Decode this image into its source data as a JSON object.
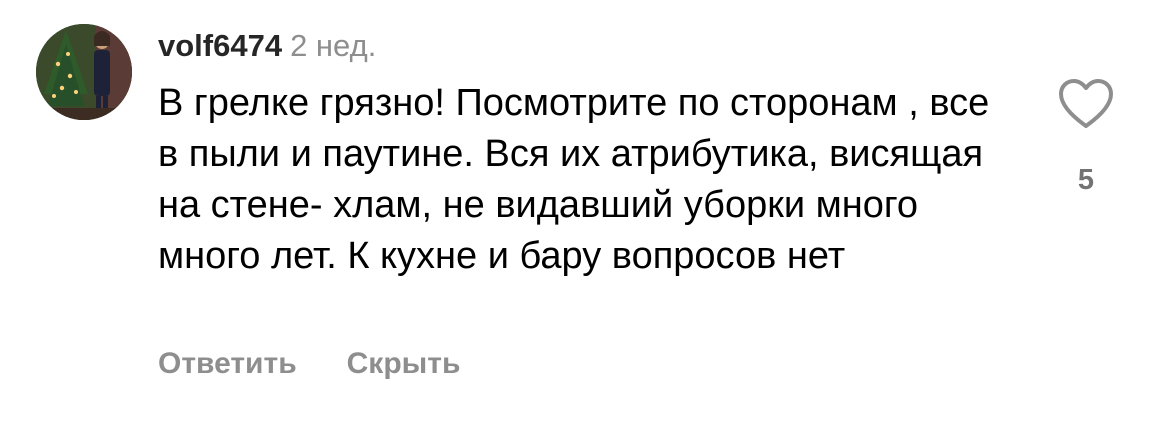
{
  "comment": {
    "avatar_icon": "user-avatar-photo",
    "username": "volf6474",
    "timestamp": "2 нед.",
    "text": "В грелке грязно! Посмотрите по сторонам , все в пыли и паутине. Вся их атрибутика, висящая на стене- хлам, не видавший уборки много много лет. К кухне и бару вопросов нет",
    "like_icon": "heart-outline-icon",
    "like_count": "5",
    "actions": {
      "reply_label": "Ответить",
      "hide_label": "Скрыть"
    }
  },
  "colors": {
    "username": "#262626",
    "secondary_text": "#8e8e8e",
    "like_count": "#737373",
    "heart_stroke": "#8e8e8e",
    "background": "#ffffff"
  }
}
